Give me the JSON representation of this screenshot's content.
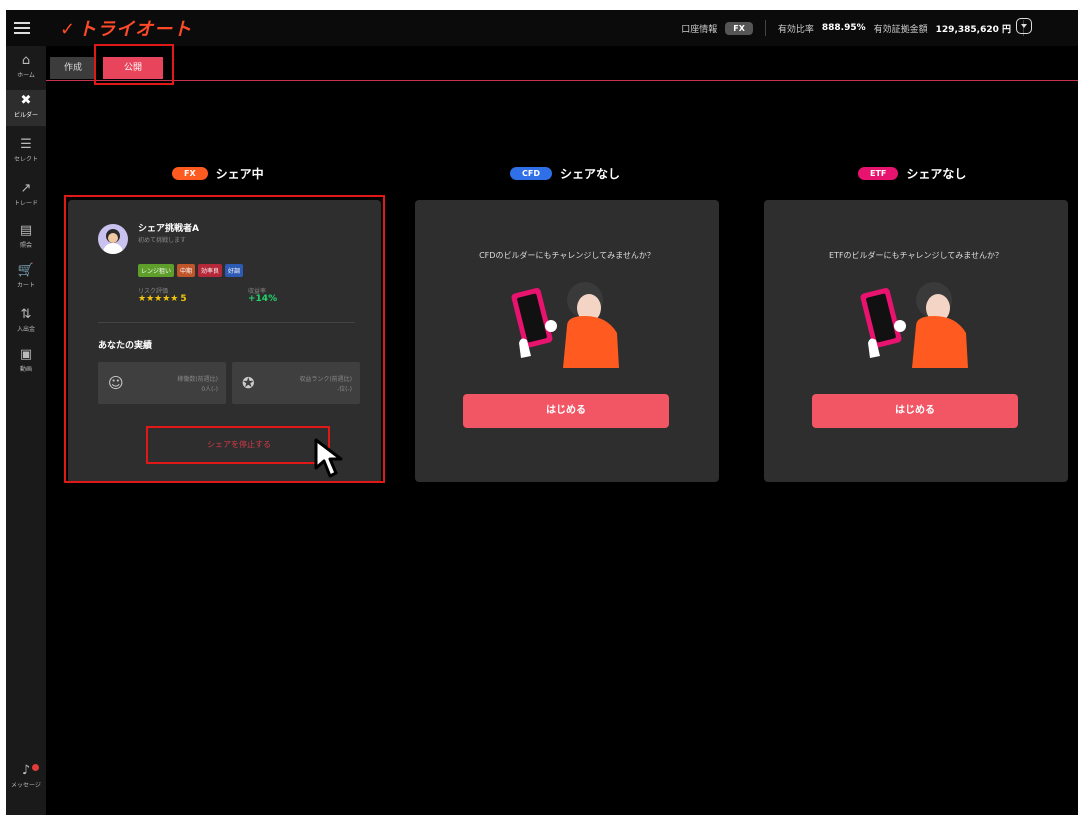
{
  "header": {
    "logo_text": "トライオート",
    "account_info_label": "口座情報",
    "account_type": "FX",
    "ratio_label": "有効比率",
    "ratio_value": "888.95%",
    "margin_label": "有効証拠金額",
    "margin_value": "129,385,620 円"
  },
  "sidebar": {
    "items": [
      {
        "label": "ホーム",
        "icon": "home-icon",
        "glyph": "⌂"
      },
      {
        "label": "ビルダー",
        "icon": "tools-icon",
        "glyph": "✖"
      },
      {
        "label": "セレクト",
        "icon": "select-icon",
        "glyph": "☰"
      },
      {
        "label": "トレード",
        "icon": "trade-icon",
        "glyph": "↗"
      },
      {
        "label": "照会",
        "icon": "inquiry-icon",
        "glyph": "▤"
      },
      {
        "label": "カート",
        "icon": "cart-icon",
        "glyph": "🛒"
      },
      {
        "label": "入出金",
        "icon": "transfer-icon",
        "glyph": "⇅"
      },
      {
        "label": "動画",
        "icon": "video-icon",
        "glyph": "▣"
      }
    ],
    "message_label": "メッセージ"
  },
  "tabs": [
    {
      "label": "作成"
    },
    {
      "label": "公開"
    }
  ],
  "sections": {
    "fx": {
      "badge": "FX",
      "status": "シェア中",
      "badge_color": "#ff5a1f"
    },
    "cfd": {
      "badge": "CFD",
      "status": "シェアなし",
      "badge_color": "#2f6fe8"
    },
    "etf": {
      "badge": "ETF",
      "status": "シェアなし",
      "badge_color": "#e8136f"
    }
  },
  "fx_card": {
    "user_name": "シェア挑戦者A",
    "user_sub": "初めて挑戦します",
    "tags": [
      {
        "label": "レンジ狙い",
        "color": "#5e9e2a"
      },
      {
        "label": "中期",
        "color": "#c0552a"
      },
      {
        "label": "効率良",
        "color": "#b5283a"
      },
      {
        "label": "好調",
        "color": "#2c5ab5"
      }
    ],
    "risk_label": "リスク評価",
    "stars": "★★★★★",
    "risk_value": "5",
    "return_label": "収益率",
    "return_value": "+14%",
    "perf_title": "あなたの実績",
    "perf_boxes": [
      {
        "label": "稼働数(前週比)",
        "value": "0人(-)",
        "icon": "user-check-icon"
      },
      {
        "label": "収益ランク(前週比)",
        "value": "-位(-)",
        "icon": "star-badge-icon"
      }
    ],
    "stop_button": "シェアを停止する"
  },
  "cfd_card": {
    "message": "CFDのビルダーにもチャレンジしてみませんか？",
    "button": "はじめる"
  },
  "etf_card": {
    "message": "ETFのビルダーにもチャレンジしてみませんか？",
    "button": "はじめる"
  }
}
